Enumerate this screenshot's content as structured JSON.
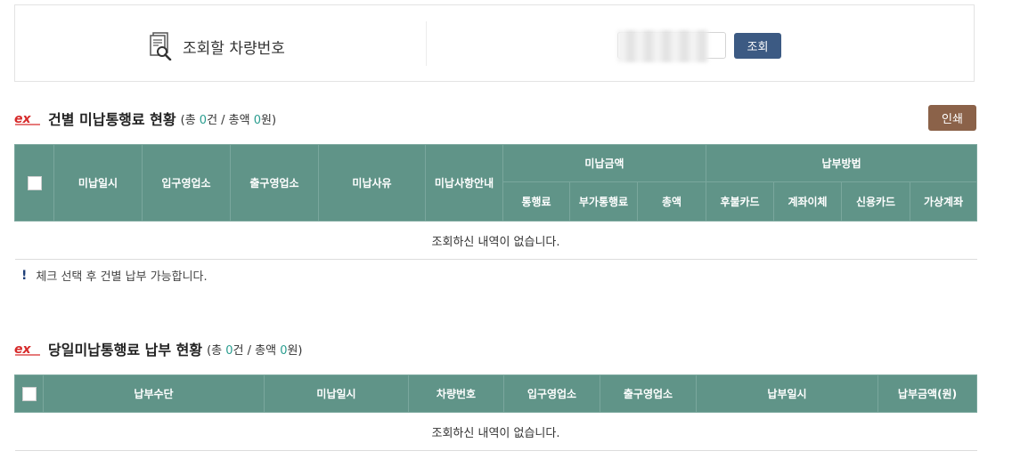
{
  "search": {
    "label": "조회할 차량번호",
    "input_value": "",
    "button_label": "조회"
  },
  "section1": {
    "logo_text": "ex",
    "title": "건별 미납통행료 현황",
    "summary_prefix": "(총 ",
    "count": "0",
    "summary_mid": "건 / 총액 ",
    "amount": "0",
    "summary_suffix": "원)",
    "print_label": "인쇄",
    "headers": {
      "date": "미납일시",
      "entry": "입구영업소",
      "exit": "출구영업소",
      "reason": "미납사유",
      "guide": "미납사항안내",
      "amount_group": "미납금액",
      "toll": "통행료",
      "extra_toll": "부가통행료",
      "total": "총액",
      "method_group": "납부방법",
      "postpaid_card": "후불카드",
      "account_transfer": "계좌이체",
      "credit_card": "신용카드",
      "virtual_account": "가상계좌"
    },
    "empty_message": "조회하신 내역이 없습니다.",
    "notice": "체크 선택 후 건별 납부 가능합니다."
  },
  "section2": {
    "logo_text": "ex",
    "title": "당일미납통행료 납부 현황",
    "summary_prefix": "(총 ",
    "count": "0",
    "summary_mid": "건 / 총액 ",
    "amount": "0",
    "summary_suffix": "원)",
    "headers": {
      "pay_method": "납부수단",
      "unpaid_date": "미납일시",
      "plate": "차량번호",
      "entry": "입구영업소",
      "exit": "출구영업소",
      "pay_date": "납부일시",
      "pay_amount": "납부금액(원)"
    },
    "empty_message": "조회하신 내역이 없습니다."
  },
  "colors": {
    "header_bg": "#609488",
    "search_button": "#3c5a83",
    "print_button": "#8b6249",
    "count_highlight": "#2a9d8f",
    "logo_red": "#d62a2a"
  }
}
